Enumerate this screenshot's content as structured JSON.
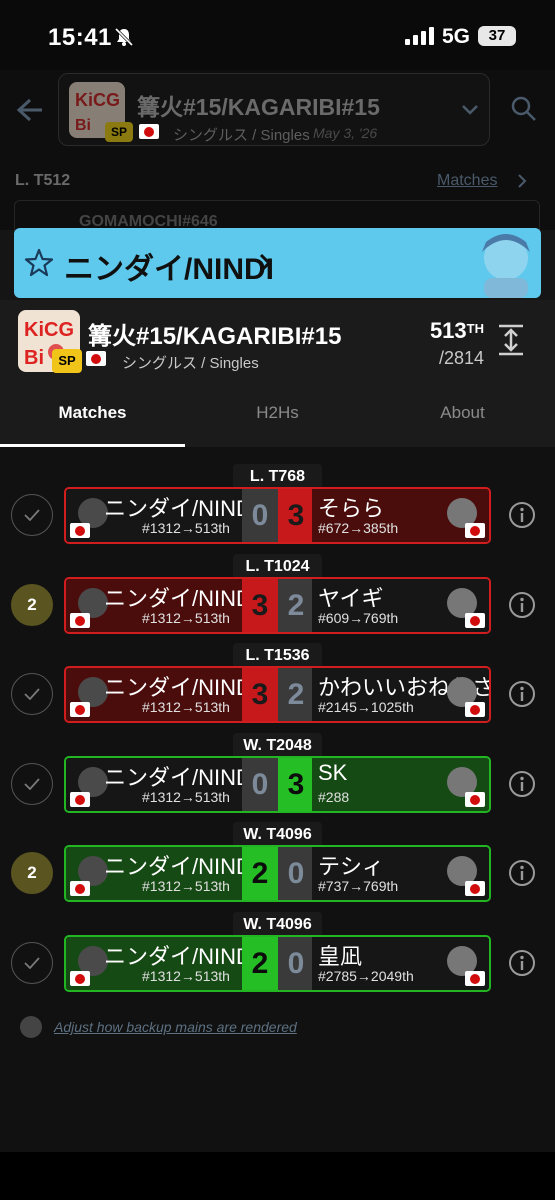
{
  "status_bar": {
    "time": "15:41",
    "network": "5G",
    "battery": "37"
  },
  "background": {
    "tournament_title": "篝火#15/KAGARIBI#15",
    "badge": "SP",
    "event_type": "シングルス / Singles",
    "date": "May 3, '26",
    "result": "L. T512",
    "matches_link": "Matches",
    "card_name": "GOMAMOCHI#646"
  },
  "banner": {
    "player_name": "ニンダイ/NINDI",
    "color": "#5ec9ec"
  },
  "tournament": {
    "name": "篝火#15/KAGARIBI#15",
    "badge": "SP",
    "event_type": "シングルス / Singles",
    "placement": "513",
    "placement_suffix": "TH",
    "entrants": "/2814"
  },
  "tabs": [
    {
      "label": "Matches",
      "active": true
    },
    {
      "label": "H2Hs",
      "active": false
    },
    {
      "label": "About",
      "active": false
    }
  ],
  "matches": [
    {
      "round": "L. T768",
      "status": "check",
      "status_text": "",
      "result": "loss",
      "p1_name": "ニンダイ/NINDI",
      "p1_seed": "#1312→513th",
      "p1_score": "0",
      "p2_name": "そらら",
      "p2_seed": "#672→385th",
      "p2_score": "3"
    },
    {
      "round": "L. T1024",
      "status": "number",
      "status_text": "2",
      "result": "loss",
      "p1_name": "ニンダイ/NINDI",
      "p1_seed": "#1312→513th",
      "p1_score": "3",
      "p2_name": "ヤイギ",
      "p2_seed": "#609→769th",
      "p2_score": "2"
    },
    {
      "round": "L. T1536",
      "status": "check",
      "status_text": "",
      "result": "loss",
      "p1_name": "ニンダイ/NINDI",
      "p1_seed": "#1312→513th",
      "p1_score": "3",
      "p2_name": "かわいいおねえさ",
      "p2_seed": "#2145→1025th",
      "p2_score": "2"
    },
    {
      "round": "W. T2048",
      "status": "check",
      "status_text": "",
      "result": "win",
      "p1_name": "ニンダイ/NINDI",
      "p1_seed": "#1312→513th",
      "p1_score": "0",
      "p2_name": "SK",
      "p2_seed": "#288",
      "p2_score": "3"
    },
    {
      "round": "W. T4096",
      "status": "number",
      "status_text": "2",
      "result": "win",
      "p1_name": "ニンダイ/NINDI",
      "p1_seed": "#1312→513th",
      "p1_score": "2",
      "p2_name": "テシィ",
      "p2_seed": "#737→769th",
      "p2_score": "0"
    },
    {
      "round": "W. T4096",
      "status": "check",
      "status_text": "",
      "result": "win",
      "p1_name": "ニンダイ/NINDI",
      "p1_seed": "#1312→513th",
      "p1_score": "2",
      "p2_name": "皇凪",
      "p2_seed": "#2785→2049th",
      "p2_score": "0"
    }
  ],
  "footer_link": "Adjust how backup mains are rendered",
  "colors": {
    "loss": "#d11d1d",
    "win": "#22b622",
    "accent": "#5ec9ec",
    "sp_badge": "#f0c419"
  },
  "icons": [
    "back-arrow-icon",
    "search-icon",
    "chevron-down-icon",
    "star-icon",
    "chevron-right-icon",
    "expand-icon",
    "check-icon",
    "info-icon",
    "bell-slash-icon"
  ]
}
